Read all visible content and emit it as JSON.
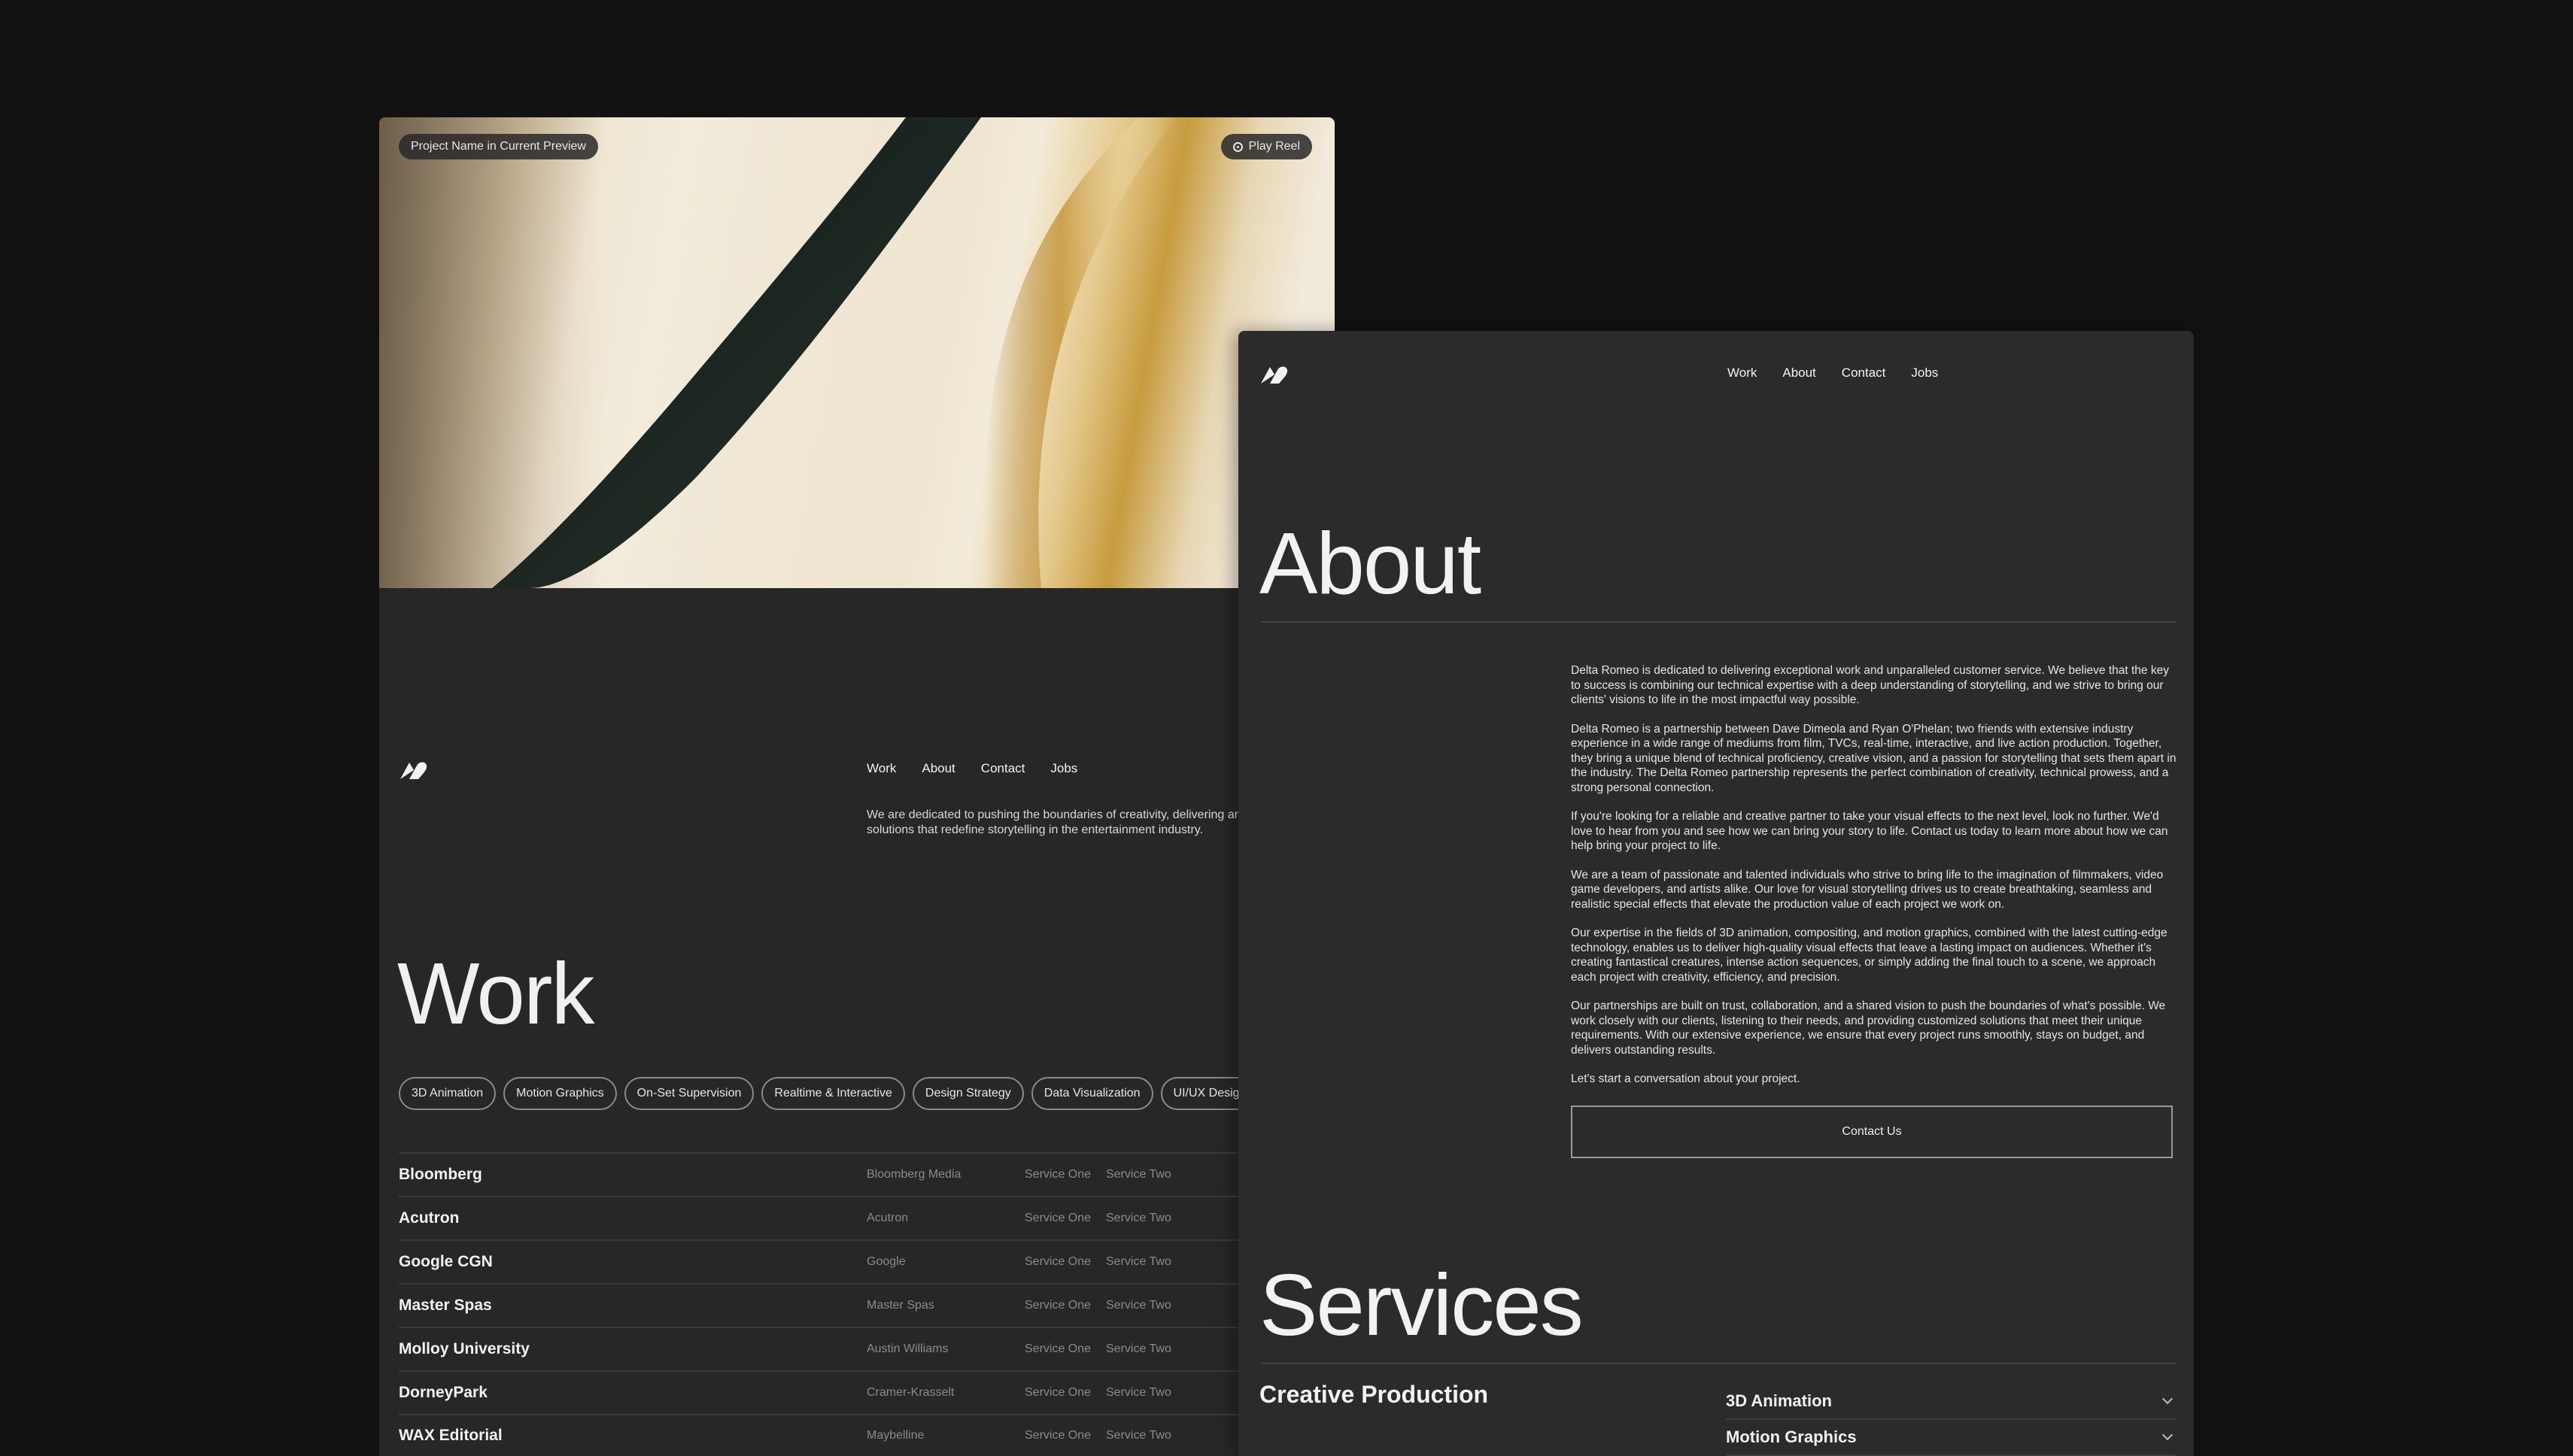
{
  "work_window": {
    "hero": {
      "project_label": "Project Name in Current Preview",
      "play_label": "Play Reel"
    },
    "nav": [
      "Work",
      "About",
      "Contact",
      "Jobs"
    ],
    "tagline": "We are dedicated to pushing the boundaries of creativity, delivering animation and VFX solutions that redefine storytelling in the entertainment industry.",
    "title": "Work",
    "tags": [
      "3D Animation",
      "Motion Graphics",
      "On-Set Supervision",
      "Realtime & Interactive",
      "Design Strategy",
      "Data Visualization",
      "UI/UX Design"
    ],
    "projects": [
      {
        "name": "Bloomberg",
        "client": "Bloomberg Media",
        "service1": "Service One",
        "service2": "Service Two"
      },
      {
        "name": "Acutron",
        "client": "Acutron",
        "service1": "Service One",
        "service2": "Service Two"
      },
      {
        "name": "Google CGN",
        "client": "Google",
        "service1": "Service One",
        "service2": "Service Two"
      },
      {
        "name": "Master Spas",
        "client": "Master Spas",
        "service1": "Service One",
        "service2": "Service Two"
      },
      {
        "name": "Molloy University",
        "client": "Austin Williams",
        "service1": "Service One",
        "service2": "Service Two"
      },
      {
        "name": "DorneyPark",
        "client": "Cramer-Krasselt",
        "service1": "Service One",
        "service2": "Service Two"
      },
      {
        "name": "WAX Editorial",
        "client": "Maybelline",
        "service1": "Service One",
        "service2": "Service Two"
      }
    ]
  },
  "about_window": {
    "nav": [
      "Work",
      "About",
      "Contact",
      "Jobs"
    ],
    "title": "About",
    "paragraphs": [
      "Delta Romeo is dedicated to delivering exceptional work and unparalleled customer service. We believe that the key to success is combining our technical expertise with a deep understanding of storytelling, and we strive to bring our clients' visions to life in the most impactful way possible.",
      "Delta Romeo is a partnership between Dave Dimeola and Ryan O'Phelan; two friends with extensive industry experience in a wide range of mediums from film, TVCs, real-time, interactive, and live action production. Together, they bring a unique blend of technical proficiency, creative vision, and a passion for storytelling that sets them apart in the industry. The Delta Romeo partnership represents the perfect combination of creativity, technical prowess, and a strong personal connection.",
      "If you're looking for a reliable and creative partner to take your visual effects to the next level, look no further. We'd love to hear from you and see how we can bring your story to life. Contact us today to learn more about how we can help bring your project to life.",
      "We are a team of passionate and talented individuals who strive to bring life to the imagination of filmmakers, video game developers, and artists alike. Our love for visual storytelling drives us to create breathtaking, seamless and realistic special effects that elevate the production value of each project we work on.",
      "Our expertise in the fields of 3D animation, compositing, and motion graphics, combined with the latest cutting-edge technology, enables us to deliver high-quality visual effects that leave a lasting impact on audiences. Whether it's creating fantastical creatures, intense action sequences, or simply adding the final touch to a scene, we approach each project with creativity, efficiency, and precision.",
      "Our partnerships are built on trust, collaboration, and a shared vision to push the boundaries of what's possible. We work closely with our clients, listening to their needs, and providing customized solutions that meet their unique requirements. With our extensive experience, we ensure that every project runs smoothly, stays on budget, and delivers outstanding results.",
      "Let's start a conversation about your project."
    ],
    "contact_button": "Contact Us",
    "services_title": "Services",
    "services_group": "Creative Production",
    "services": [
      "3D Animation",
      "Motion Graphics"
    ]
  },
  "icons": {
    "logo": "delta-romeo-logo-icon",
    "play": "play-circle-icon",
    "chevron": "chevron-down-icon"
  },
  "colors": {
    "background": "#121212",
    "panel": "#272727",
    "panel_about": "#2b2b2b",
    "muted_text": "#8a8a8a"
  }
}
